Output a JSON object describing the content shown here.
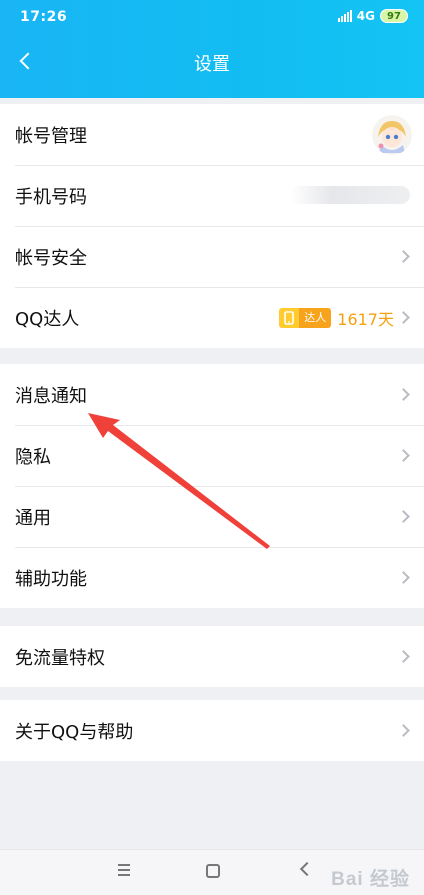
{
  "status_bar": {
    "time": "17:26",
    "network": "4G",
    "battery": "97"
  },
  "header": {
    "back_icon": "chevron-left-icon",
    "title": "设置"
  },
  "groups": [
    {
      "items": [
        {
          "label": "帐号管理",
          "trailing": "avatar"
        },
        {
          "label": "手机号码",
          "trailing": "blurred-value"
        },
        {
          "label": "帐号安全",
          "trailing": "chevron"
        },
        {
          "label": "QQ达人",
          "trailing": "badge",
          "badge_text": "达人",
          "days": "1617天"
        }
      ]
    },
    {
      "items": [
        {
          "label": "消息通知"
        },
        {
          "label": "隐私"
        },
        {
          "label": "通用"
        },
        {
          "label": "辅助功能"
        }
      ]
    },
    {
      "items": [
        {
          "label": "免流量特权"
        }
      ]
    },
    {
      "items": [
        {
          "label": "关于QQ与帮助"
        }
      ]
    }
  ],
  "annotation": {
    "color": "#f0403a",
    "points_to": "消息通知"
  },
  "colors": {
    "header": "#14bdf3",
    "days": "#f5a111",
    "badge": "#f7a31c"
  },
  "watermark": "Bai 经验"
}
